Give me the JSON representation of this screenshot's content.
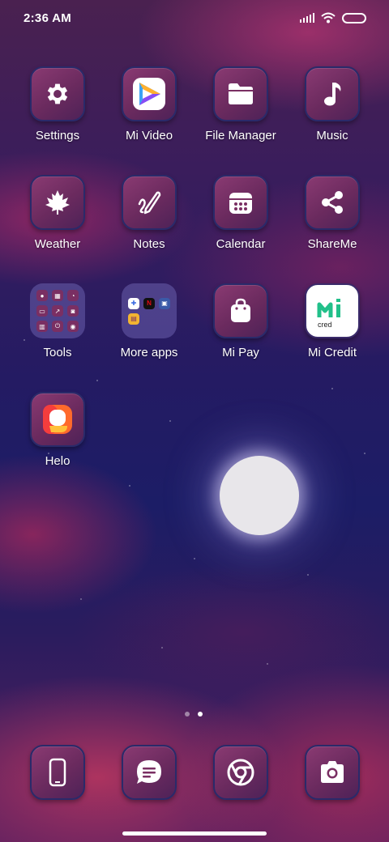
{
  "status_bar": {
    "time": "2:36 AM"
  },
  "apps": [
    {
      "label": "Settings",
      "icon": "gear-icon"
    },
    {
      "label": "Mi Video",
      "icon": "play-icon"
    },
    {
      "label": "File Manager",
      "icon": "folder-icon"
    },
    {
      "label": "Music",
      "icon": "music-note-icon"
    },
    {
      "label": "Weather",
      "icon": "maple-leaf-icon"
    },
    {
      "label": "Notes",
      "icon": "pen-icon"
    },
    {
      "label": "Calendar",
      "icon": "calendar-icon"
    },
    {
      "label": "ShareMe",
      "icon": "share-icon"
    },
    {
      "label": "Tools",
      "icon": "folder-tools-icon"
    },
    {
      "label": "More apps",
      "icon": "folder-more-apps-icon"
    },
    {
      "label": "Mi Pay",
      "icon": "shopping-bag-icon"
    },
    {
      "label": "Mi Credit",
      "icon": "mi-credit-logo-icon"
    },
    {
      "label": "Helo",
      "icon": "helo-logo-icon"
    }
  ],
  "dock": [
    {
      "name": "phone",
      "icon": "phone-icon"
    },
    {
      "name": "messaging",
      "icon": "chat-bubble-icon"
    },
    {
      "name": "browser",
      "icon": "chrome-icon"
    },
    {
      "name": "camera",
      "icon": "camera-icon"
    }
  ],
  "page_indicator": {
    "pages": 2,
    "current": 2
  },
  "colors": {
    "icon_bg": "#7a2f63",
    "icon_border": "#2a2a6a"
  }
}
